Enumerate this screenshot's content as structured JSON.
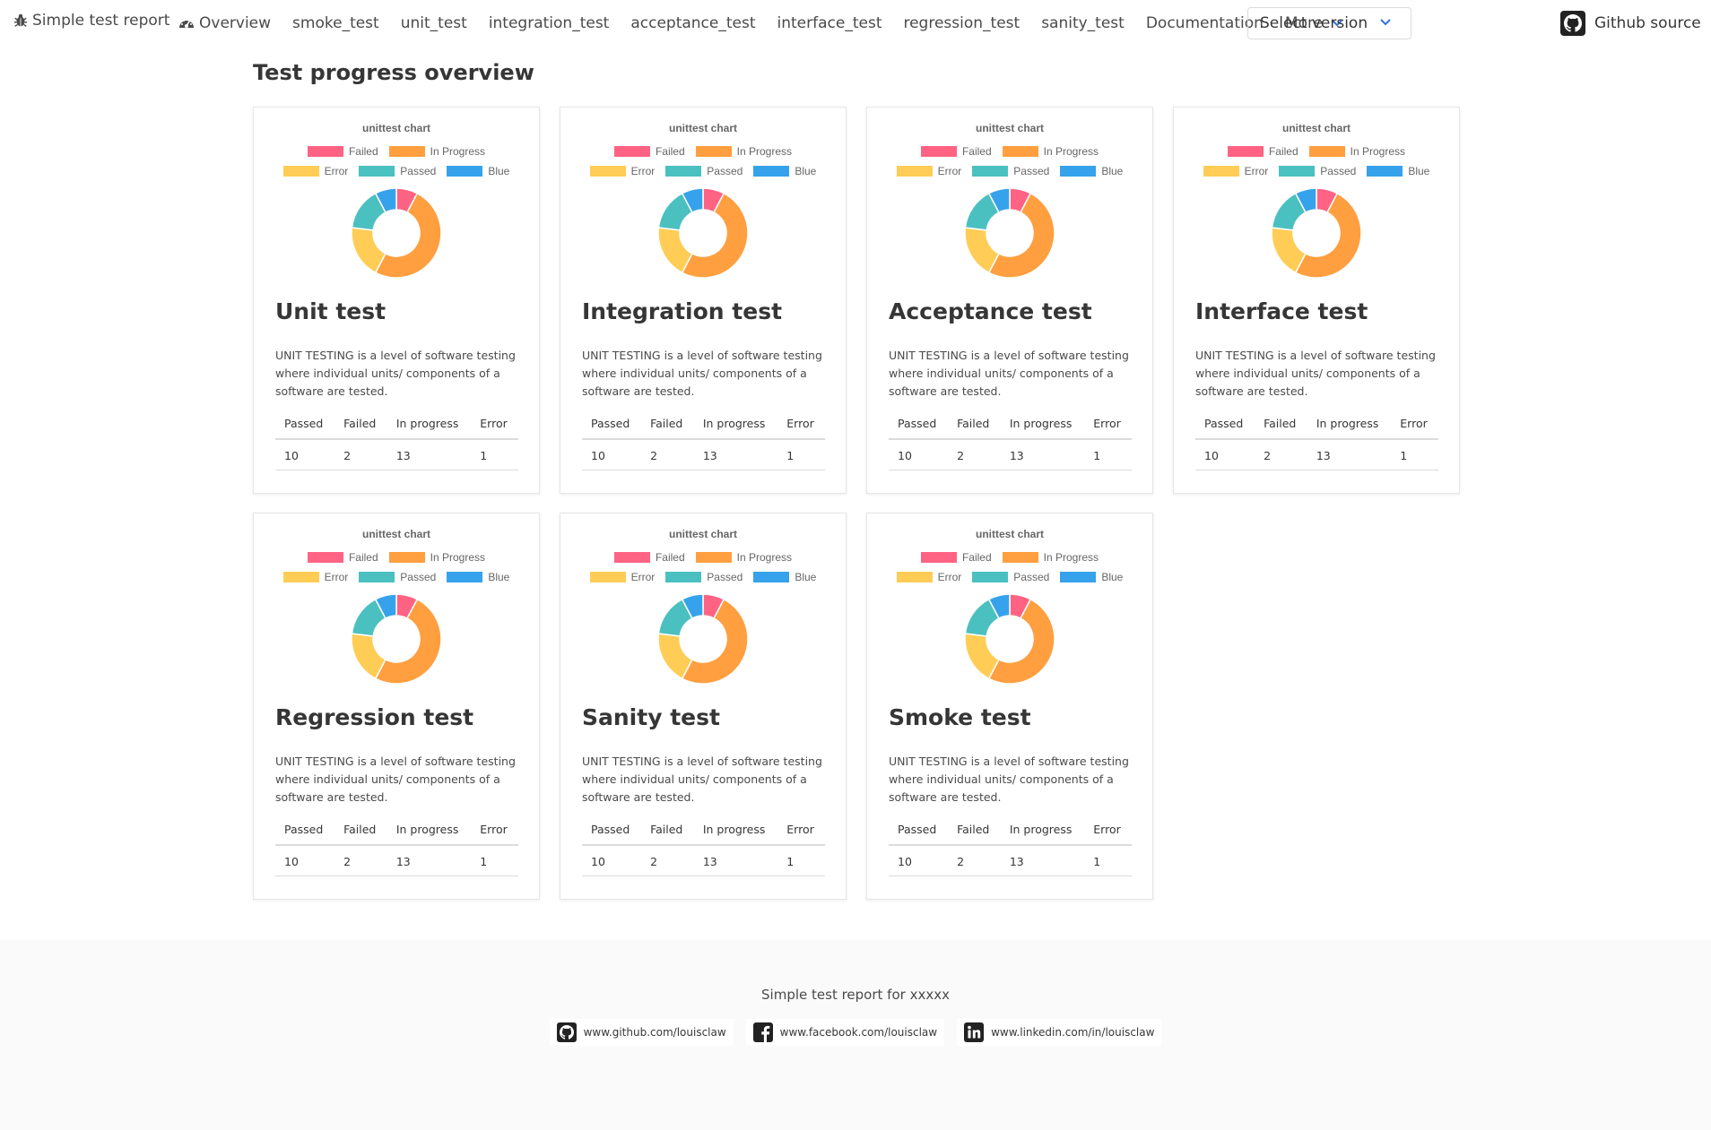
{
  "nav": {
    "brand": "Simple test report",
    "items": [
      {
        "label": "Overview",
        "name": "nav-overview"
      },
      {
        "label": "smoke_test",
        "name": "nav-smoke-test"
      },
      {
        "label": "unit_test",
        "name": "nav-unit-test"
      },
      {
        "label": "integration_test",
        "name": "nav-integration-test"
      },
      {
        "label": "acceptance_test",
        "name": "nav-acceptance-test"
      },
      {
        "label": "interface_test",
        "name": "nav-interface-test"
      },
      {
        "label": "regression_test",
        "name": "nav-regression-test"
      },
      {
        "label": "sanity_test",
        "name": "nav-sanity-test"
      },
      {
        "label": "Documentation",
        "name": "nav-documentation"
      }
    ],
    "more": "More",
    "version_select": "Select version",
    "github": "Github source"
  },
  "page_title": "Test progress overview",
  "colors": {
    "failed": "#ff6384",
    "in_progress": "#ff9f40",
    "error": "#ffcd56",
    "passed": "#4bc0c0",
    "blue": "#36a2eb"
  },
  "chart_data": {
    "type": "pie",
    "variant": "doughnut",
    "title": "unittest chart",
    "legend_position": "top",
    "categories": [
      "Failed",
      "In Progress",
      "Error",
      "Passed",
      "Blue"
    ],
    "values": [
      2,
      13,
      5,
      4,
      2
    ]
  },
  "table_headers": [
    "Passed",
    "Failed",
    "In progress",
    "Error"
  ],
  "cards": [
    {
      "title": "Unit test",
      "description": "UNIT TESTING is a level of software testing where individual units/ components of a software are tested.",
      "stats": [
        "10",
        "2",
        "13",
        "1"
      ]
    },
    {
      "title": "Integration test",
      "description": "UNIT TESTING is a level of software testing where individual units/ components of a software are tested.",
      "stats": [
        "10",
        "2",
        "13",
        "1"
      ]
    },
    {
      "title": "Acceptance test",
      "description": "UNIT TESTING is a level of software testing where individual units/ components of a software are tested.",
      "stats": [
        "10",
        "2",
        "13",
        "1"
      ]
    },
    {
      "title": "Interface test",
      "description": "UNIT TESTING is a level of software testing where individual units/ components of a software are tested.",
      "stats": [
        "10",
        "2",
        "13",
        "1"
      ]
    },
    {
      "title": "Regression test",
      "description": "UNIT TESTING is a level of software testing where individual units/ components of a software are tested.",
      "stats": [
        "10",
        "2",
        "13",
        "1"
      ]
    },
    {
      "title": "Sanity test",
      "description": "UNIT TESTING is a level of software testing where individual units/ components of a software are tested.",
      "stats": [
        "10",
        "2",
        "13",
        "1"
      ]
    },
    {
      "title": "Smoke test",
      "description": "UNIT TESTING is a level of software testing where individual units/ components of a software are tested.",
      "stats": [
        "10",
        "2",
        "13",
        "1"
      ]
    }
  ],
  "footer": {
    "text": "Simple test report for xxxxx",
    "links": [
      {
        "label": "www.github.com/louisclaw",
        "icon": "github-icon"
      },
      {
        "label": "www.facebook.com/louisclaw",
        "icon": "facebook-icon"
      },
      {
        "label": "www.linkedin.com/in/louisclaw",
        "icon": "linkedin-icon"
      }
    ]
  }
}
